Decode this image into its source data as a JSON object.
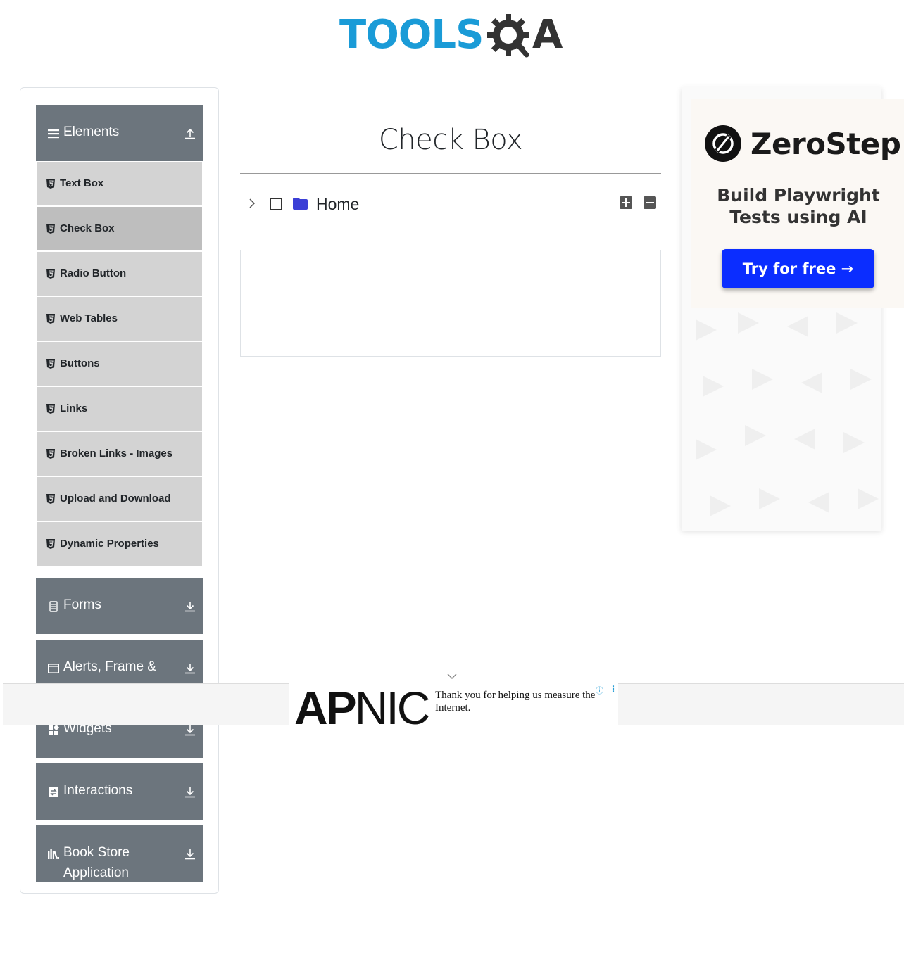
{
  "header": {
    "logo_text": "TOOLS",
    "logo_suffix": "A"
  },
  "sidebar": {
    "groups": [
      {
        "label": "Elements",
        "icon": "hamburger-icon",
        "state": "expanded"
      },
      {
        "label": "Forms",
        "icon": "form-icon",
        "state": "collapsed"
      },
      {
        "label": "Alerts, Frame &",
        "icon": "window-icon",
        "state": "collapsed"
      },
      {
        "label": "Widgets",
        "icon": "widgets-icon",
        "state": "collapsed"
      },
      {
        "label": "Interactions",
        "icon": "interactions-icon",
        "state": "collapsed"
      },
      {
        "label": "Book Store Application",
        "icon": "books-icon",
        "state": "collapsed"
      }
    ],
    "items": [
      {
        "label": "Text Box"
      },
      {
        "label": "Check Box",
        "active": true
      },
      {
        "label": "Radio Button"
      },
      {
        "label": "Web Tables"
      },
      {
        "label": "Buttons"
      },
      {
        "label": "Links"
      },
      {
        "label": "Broken Links - Images"
      },
      {
        "label": "Upload and Download"
      },
      {
        "label": "Dynamic Properties"
      }
    ]
  },
  "main": {
    "title": "Check Box",
    "tree": {
      "node_label": "Home",
      "checked": false,
      "expanded": false
    }
  },
  "ad_right": {
    "brand": "ZeroStep",
    "tagline": "Build Playwright Tests using AI",
    "cta": "Try for free →",
    "cta_color": "#0b2dff"
  },
  "ad_bottom": {
    "brand_bold": "AP",
    "brand_thin": "NIC",
    "message": "Thank you for helping us measure the Internet.",
    "info_glyph": "ⓘ",
    "menu_glyph": "⋮"
  },
  "colors": {
    "group_bg": "#6c757d",
    "item_bg": "#d3d3d3",
    "item_active_bg": "#bebebe",
    "logo_blue": "#1a9bd7"
  }
}
